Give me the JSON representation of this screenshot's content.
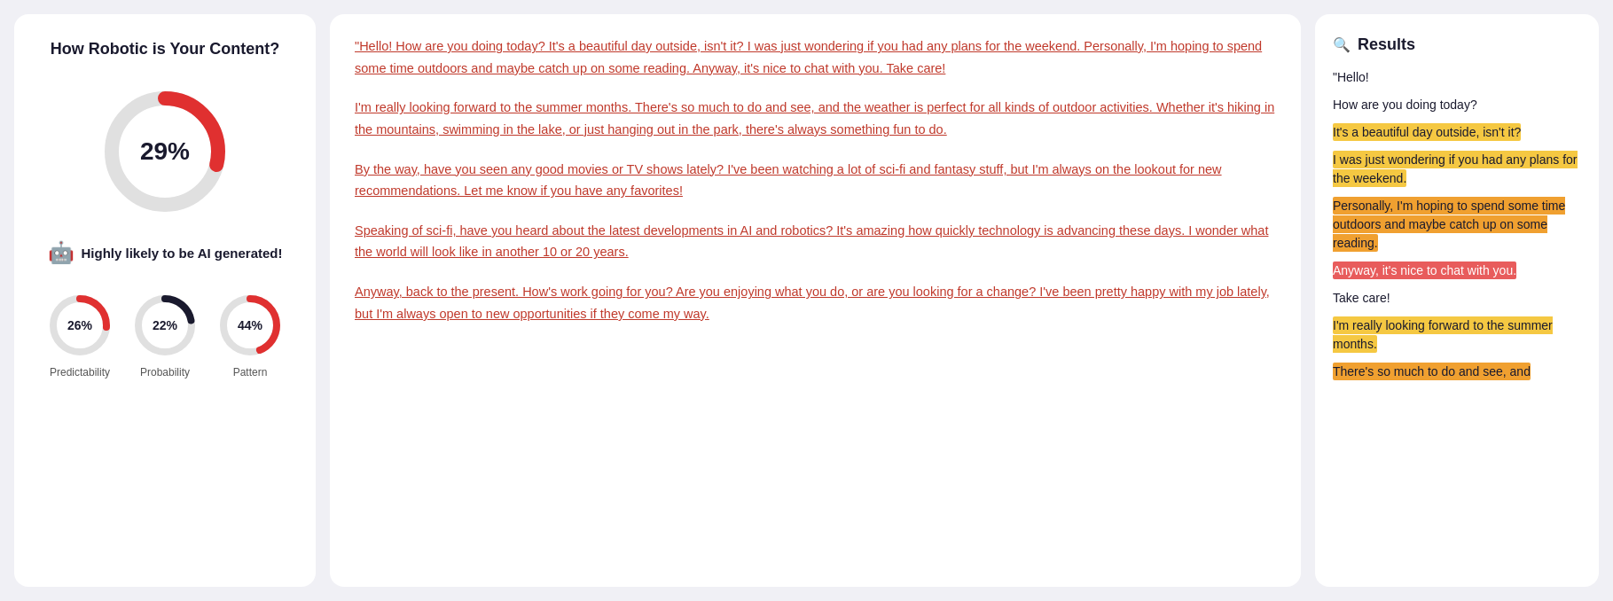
{
  "leftPanel": {
    "title": "How Robotic is Your Content?",
    "mainPercent": "29%",
    "mainPercentValue": 29,
    "robotLabel": "Highly likely to be AI generated!",
    "robotEmoji": "🤖",
    "miniCircles": [
      {
        "label": "Predictability",
        "percent": "26%",
        "value": 26
      },
      {
        "label": "Probability",
        "percent": "22%",
        "value": 22
      },
      {
        "label": "Pattern",
        "percent": "44%",
        "value": 44
      }
    ]
  },
  "middlePanel": {
    "paragraphs": [
      "\"Hello! How are you doing today? It's a beautiful day outside, isn't it? I was just wondering if you had any plans for the weekend. Personally, I'm hoping to spend some time outdoors and maybe catch up on some reading. Anyway, it's nice to chat with you. Take care!",
      "I'm really looking forward to the summer months. There's so much to do and see, and the weather is perfect for all kinds of outdoor activities. Whether it's hiking in the mountains, swimming in the lake, or just hanging out in the park, there's always something fun to do.",
      "By the way, have you seen any good movies or TV shows lately? I've been watching a lot of sci-fi and fantasy stuff, but I'm always on the lookout for new recommendations. Let me know if you have any favorites!",
      "Speaking of sci-fi, have you heard about the latest developments in AI and robotics? It's amazing how quickly technology is advancing these days. I wonder what the world will look like in another 10 or 20 years.",
      "Anyway, back to the present. How's work going for you? Are you enjoying what you do, or are you looking for a change? I've been pretty happy with my job lately, but I'm always open to new opportunities if they come my way."
    ]
  },
  "rightPanel": {
    "title": "Results",
    "items": [
      {
        "text": "\"Hello!",
        "highlight": "none"
      },
      {
        "text": "How are you doing today?",
        "highlight": "none"
      },
      {
        "text": "It's a beautiful day outside, isn't it?",
        "highlight": "yellow"
      },
      {
        "text": "I was just wondering if you had any plans for the weekend.",
        "highlight": "yellow"
      },
      {
        "text": "Personally, I'm hoping to spend some time outdoors and maybe catch up on some reading.",
        "highlight": "orange"
      },
      {
        "text": "Anyway, it's nice to chat with you.",
        "highlight": "red"
      },
      {
        "text": "Take care!",
        "highlight": "none"
      },
      {
        "text": "I'm really looking forward to the summer months.",
        "highlight": "yellow"
      },
      {
        "text": "There's so much to do and see, and",
        "highlight": "orange"
      }
    ]
  }
}
